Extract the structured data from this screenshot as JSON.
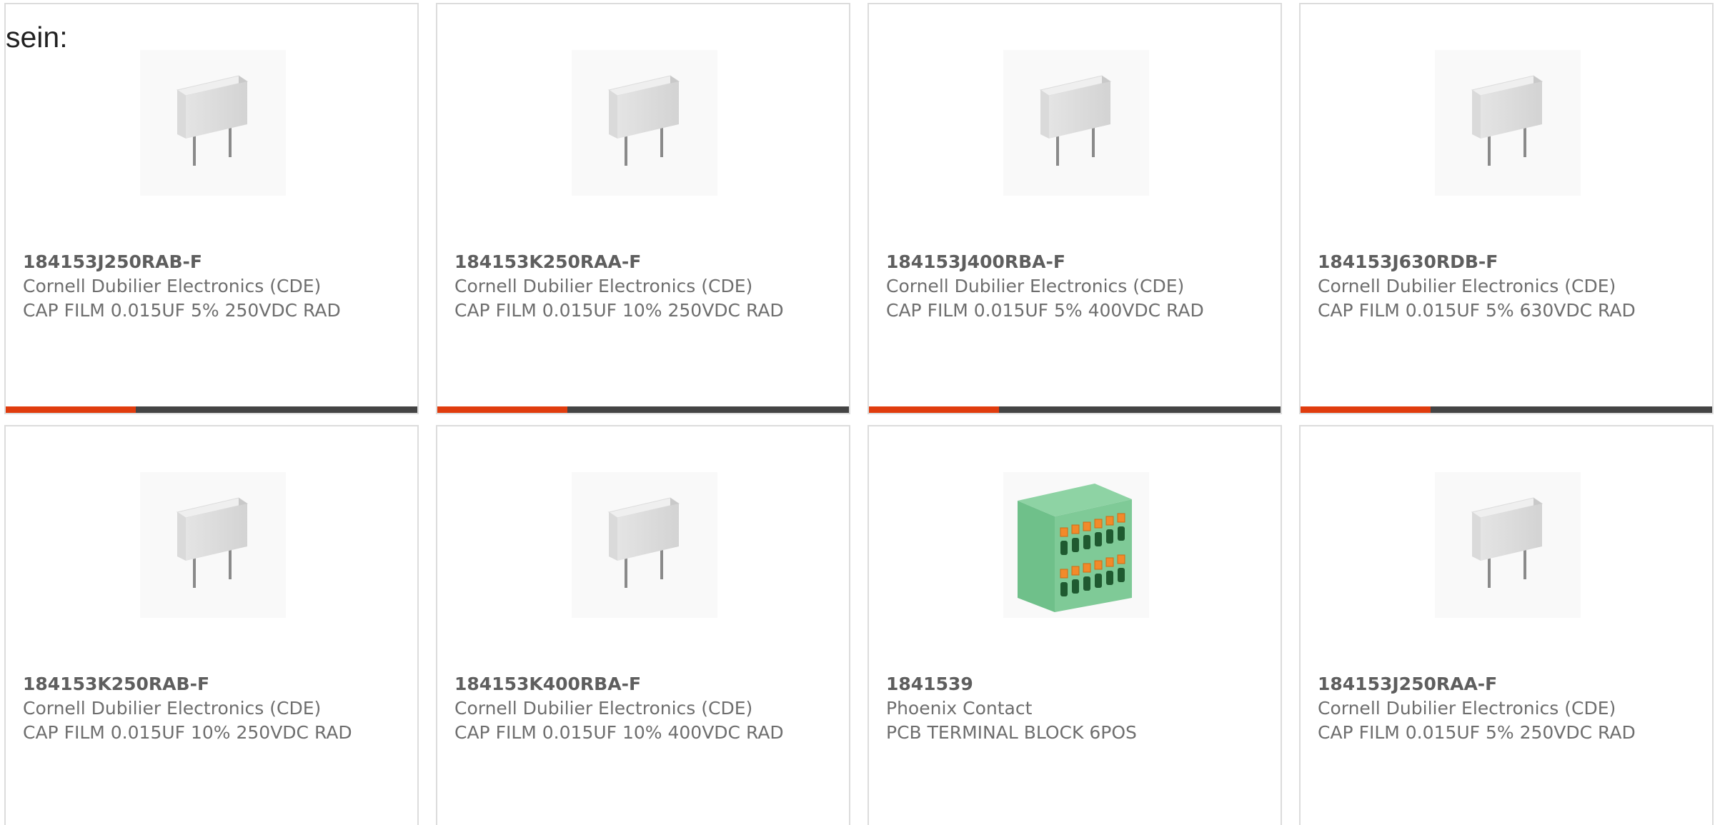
{
  "intro_text": "sein:",
  "colors": {
    "accent": "#e03c0e",
    "bar": "#444444",
    "border": "#dcdcdc"
  },
  "products": [
    {
      "part_number": "184153J250RAB-F",
      "manufacturer": "Cornell Dubilier Electronics (CDE)",
      "description": "CAP FILM 0.015UF 5% 250VDC RAD",
      "image": "film-capacitor"
    },
    {
      "part_number": "184153K250RAA-F",
      "manufacturer": "Cornell Dubilier Electronics (CDE)",
      "description": "CAP FILM 0.015UF 10% 250VDC RAD",
      "image": "film-capacitor"
    },
    {
      "part_number": "184153J400RBA-F",
      "manufacturer": "Cornell Dubilier Electronics (CDE)",
      "description": "CAP FILM 0.015UF 5% 400VDC RAD",
      "image": "film-capacitor"
    },
    {
      "part_number": "184153J630RDB-F",
      "manufacturer": "Cornell Dubilier Electronics (CDE)",
      "description": "CAP FILM 0.015UF 5% 630VDC RAD",
      "image": "film-capacitor"
    },
    {
      "part_number": "184153K250RAB-F",
      "manufacturer": "Cornell Dubilier Electronics (CDE)",
      "description": "CAP FILM 0.015UF 10% 250VDC RAD",
      "image": "film-capacitor"
    },
    {
      "part_number": "184153K400RBA-F",
      "manufacturer": "Cornell Dubilier Electronics (CDE)",
      "description": "CAP FILM 0.015UF 10% 400VDC RAD",
      "image": "film-capacitor"
    },
    {
      "part_number": "1841539",
      "manufacturer": "Phoenix Contact",
      "description": "PCB TERMINAL BLOCK 6POS",
      "image": "terminal-block"
    },
    {
      "part_number": "184153J250RAA-F",
      "manufacturer": "Cornell Dubilier Electronics (CDE)",
      "description": "CAP FILM 0.015UF 5% 250VDC RAD",
      "image": "film-capacitor"
    }
  ]
}
